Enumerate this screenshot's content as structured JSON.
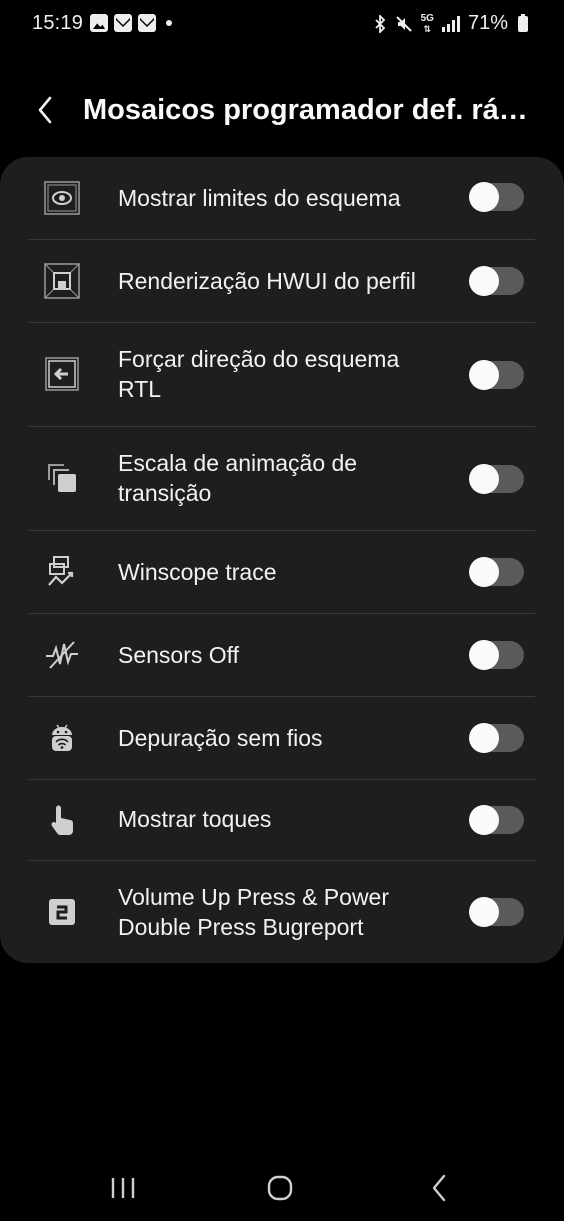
{
  "status_bar": {
    "time": "15:19",
    "battery": "71%",
    "network": "5G",
    "left_icons": [
      "gallery-icon",
      "mail-icon",
      "mail-icon",
      "dot-icon"
    ],
    "right_icons": [
      "bluetooth-icon",
      "mute-icon",
      "5g-icon",
      "signal-icon",
      "battery-icon"
    ]
  },
  "header": {
    "title": "Mosaicos programador def. rá…",
    "back_icon": "chevron-left-icon"
  },
  "settings": [
    {
      "label": "Mostrar limites do esquema",
      "icon": "layout-bounds-icon",
      "enabled": false
    },
    {
      "label": "Renderização HWUI do perfil",
      "icon": "gpu-profile-icon",
      "enabled": false
    },
    {
      "label": "Forçar direção do esquema RTL",
      "icon": "rtl-layout-icon",
      "enabled": false
    },
    {
      "label": "Escala de animação de transição",
      "icon": "animation-scale-icon",
      "enabled": false
    },
    {
      "label": "Winscope trace",
      "icon": "winscope-icon",
      "enabled": false
    },
    {
      "label": "Sensors Off",
      "icon": "sensors-off-icon",
      "enabled": false
    },
    {
      "label": "Depuração sem fios",
      "icon": "wireless-debugging-icon",
      "enabled": false
    },
    {
      "label": "Mostrar toques",
      "icon": "touch-icon",
      "enabled": false
    },
    {
      "label": "Volume Up Press & Power Double Press Bugreport",
      "icon": "bugreport-icon",
      "enabled": false
    }
  ],
  "nav_bar": {
    "recents_icon": "recents-icon",
    "home_icon": "home-icon",
    "back_icon": "back-icon"
  },
  "colors": {
    "background": "#000000",
    "card": "#1e1e1e",
    "toggle_off_track": "#5a5a5a",
    "toggle_knob": "#fafafa"
  }
}
